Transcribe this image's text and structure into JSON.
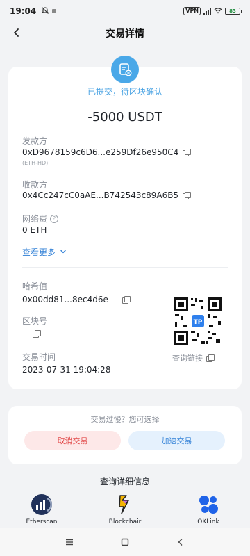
{
  "status_bar": {
    "time": "19:04",
    "vpn": "VPN",
    "battery": "83"
  },
  "header": {
    "title": "交易详情"
  },
  "transaction": {
    "status": "已提交，待区块确认",
    "amount": "-5000 USDT",
    "from_label": "发款方",
    "from_address": "0xD9678159c6D6...e259Df26e950C4",
    "from_wallet": "(ETH-HD)",
    "to_label": "收款方",
    "to_address": "0x4Cc247cC0aAE...B742543c89A6B5",
    "fee_label": "网络费",
    "fee_value": "0 ETH",
    "more_label": "查看更多",
    "hash_label": "哈希值",
    "hash_value": "0x00dd81...8ec4d6e",
    "block_label": "区块号",
    "block_value": "--",
    "time_label": "交易时间",
    "time_value": "2023-07-31 19:04:28",
    "query_link": "查询链接"
  },
  "slow_tx": {
    "question": "交易过慢？您可选择",
    "cancel_label": "取消交易",
    "speed_label": "加速交易"
  },
  "explorers": {
    "title": "查询详细信息",
    "items": [
      {
        "name": "Etherscan",
        "icon": "etherscan-logo-icon"
      },
      {
        "name": "Blockchair",
        "icon": "blockchair-logo-icon"
      },
      {
        "name": "OKLink",
        "icon": "oklink-logo-icon"
      }
    ]
  },
  "colors": {
    "accent": "#4aa8e8",
    "link": "#2f7fd6",
    "danger": "#e24b4b"
  }
}
